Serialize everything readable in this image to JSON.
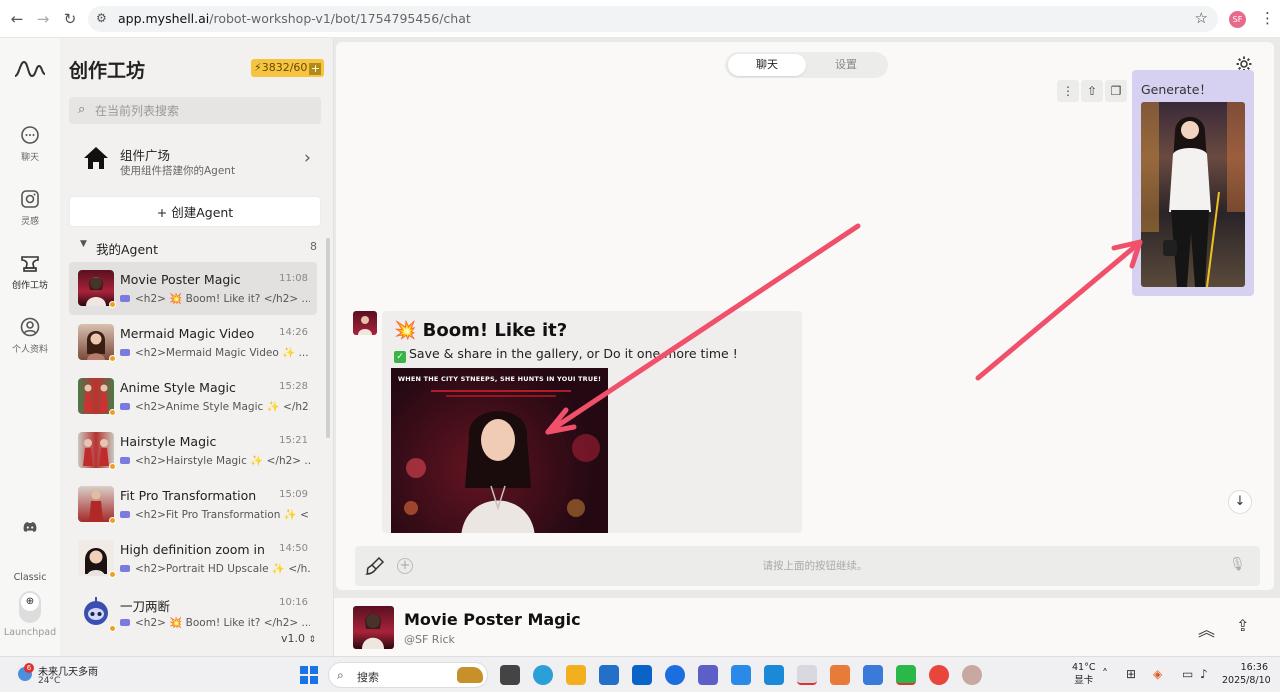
{
  "browser": {
    "url_host": "app.myshell.ai",
    "url_path": "/robot-workshop-v1/bot/1754795456/chat",
    "profile_initials": "SF"
  },
  "rail": {
    "items": [
      {
        "label": "聊天",
        "icon": "chat-bubble-icon"
      },
      {
        "label": "灵感",
        "icon": "instagram-icon"
      },
      {
        "label": "创作工坊",
        "icon": "anvil-icon"
      },
      {
        "label": "个人资料",
        "icon": "user-icon"
      }
    ],
    "classic_label": "Classic",
    "launchpad_label": "Launchpad"
  },
  "sidebar": {
    "title": "创作工坊",
    "credits": "3832/60",
    "search_placeholder": "在当前列表搜索",
    "plaza_title": "组件广场",
    "plaza_subtitle": "使用组件搭建你的Agent",
    "create_label": "+ 创建Agent",
    "my_agents_label": "我的Agent",
    "my_agents_count": "8",
    "agents": [
      {
        "name": "Movie Poster Magic",
        "time": "11:08",
        "preview": "<h2> 💥 Boom! Like it? </h2> ...",
        "avatar_color": "#a8233a"
      },
      {
        "name": "Mermaid Magic Video",
        "time": "14:26",
        "preview": "<h2>Mermaid Magic Video ✨ ...",
        "avatar_color": "#7a4a3a"
      },
      {
        "name": "Anime Style Magic",
        "time": "15:28",
        "preview": "<h2>Anime Style Magic ✨ </h2...",
        "avatar_color": "#c03030"
      },
      {
        "name": "Hairstyle Magic",
        "time": "15:21",
        "preview": "<h2>Hairstyle Magic ✨ </h2> ...",
        "avatar_color": "#b83232"
      },
      {
        "name": "Fit Pro Transformation",
        "time": "15:09",
        "preview": "<h2>Fit Pro Transformation ✨ <...",
        "avatar_color": "#a52a2a"
      },
      {
        "name": "High definition zoom in",
        "time": "14:50",
        "preview": "<h2>Portrait HD Upscale ✨ </h...",
        "avatar_color": "#3a2a28"
      },
      {
        "name": "一刀两断",
        "time": "10:16",
        "preview": "<h2> 💥 Boom! Like it? </h2> ...",
        "avatar_color": "#3b4fb0"
      }
    ],
    "version": "v1.0"
  },
  "chat": {
    "tab_chat": "聊天",
    "tab_settings": "设置",
    "user_message": "Generate！",
    "bot_heading": "💥 Boom! Like it?",
    "bot_sub": "Save & share in the gallery, or Do it one more time !",
    "poster_tagline": "WHEN THE CITY STNEEPS, SHE HUNTS IN YOUI TRUE!",
    "input_placeholder": "请按上面的按钮继续。"
  },
  "bot_info": {
    "name": "Movie Poster Magic",
    "author": "@SF Rick"
  },
  "taskbar": {
    "weather_text": "未来几天多雨",
    "weather_temp": "24°C",
    "weather_badge": "6",
    "search_label": "搜索",
    "sys_temp": "41°C",
    "sys_label": "显卡",
    "time": "16:36",
    "date": "2025/8/10"
  },
  "colors": {
    "user_bubble": "#d6d1f0",
    "credits_badge": "#f5c542",
    "arrow": "#f0506a"
  }
}
